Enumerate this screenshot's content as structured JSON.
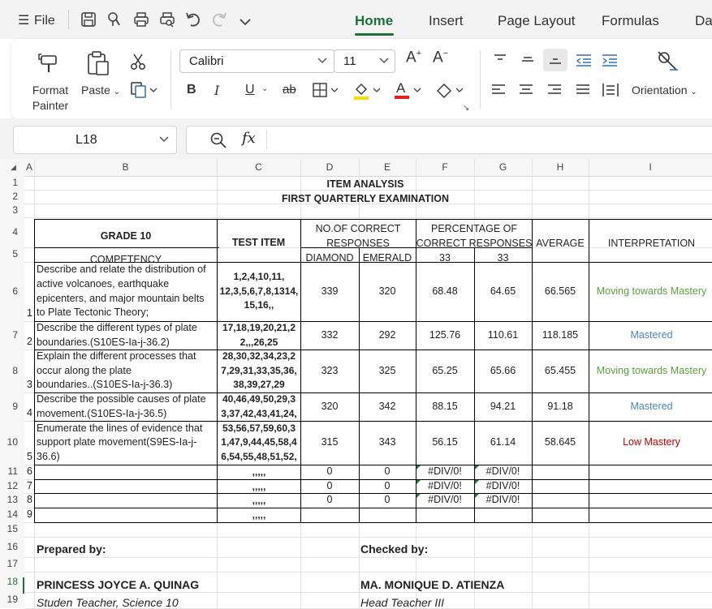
{
  "menubar": {
    "file_label": "File",
    "tabs": [
      "Home",
      "Insert",
      "Page Layout",
      "Formulas",
      "Da"
    ]
  },
  "ribbon": {
    "format_painter": "Format\nPainter",
    "paste": "Paste",
    "font_name": "Calibri",
    "font_size": "11",
    "orientation": "Orientation",
    "bold": "B",
    "italic": "I",
    "underline": "U",
    "strike": "ab"
  },
  "formula_bar": {
    "name_box": "L18",
    "fx": "fx",
    "value": ""
  },
  "grid": {
    "columns": [
      "A",
      "B",
      "C",
      "D",
      "E",
      "F",
      "G",
      "H",
      "I"
    ],
    "rows": [
      "1",
      "2",
      "3",
      "4",
      "5",
      "6",
      "7",
      "8",
      "9",
      "10",
      "11",
      "12",
      "13",
      "14",
      "15",
      "16",
      "17",
      "18",
      "19"
    ],
    "title1": "ITEM ANALYSIS",
    "title2": "FIRST QUARTERLY EXAMINATION",
    "header": {
      "grade": "GRADE 10",
      "test_item": "TEST ITEM",
      "correct_1": "NO.OF CORRECT",
      "correct_2": "RESPONSES",
      "pct_1": "PERCENTAGE OF",
      "pct_2": "CORRECT RESPONSES",
      "average": "AVERAGE",
      "interpretation": "INTERPRETATION",
      "competency": "COMPETENCY",
      "diamond": "DIAMOND",
      "emerald": "EMERALD",
      "n_diamond": "33",
      "n_emerald": "33"
    },
    "data_rows": [
      {
        "num": "1",
        "competency": [
          "Describe and relate the distribution of",
          "active volcanoes, earthquake",
          "epicenters, and major mountain belts",
          "to Plate Tectonic Theory;"
        ],
        "items": [
          "1,2,4,10,11,",
          "12,3,5,6,7,8,1314,",
          "15,16,,"
        ],
        "diamond": "339",
        "emerald": "320",
        "pct_d": "68.48",
        "pct_e": "64.65",
        "average": "66.565",
        "interpretation": "Moving towards Mastery",
        "color": "green"
      },
      {
        "num": "2",
        "competency": [
          "Describe the different types of plate",
          "boundaries.(S10ES-Ia-j-36.2)"
        ],
        "items": [
          "17,18,19,20,21,2",
          "2,,,26,25"
        ],
        "diamond": "332",
        "emerald": "292",
        "pct_d": "125.76",
        "pct_e": "110.61",
        "average": "118.185",
        "interpretation": "Mastered",
        "color": "blue"
      },
      {
        "num": "3",
        "competency": [
          "Explain the different processes that",
          "occur along the plate",
          "boundaries..(S10ES-Ia-j-36.3)"
        ],
        "items": [
          "28,30,32,34,23,2",
          "7,29,31,33,35,36,",
          "38,39,27,29"
        ],
        "diamond": "323",
        "emerald": "325",
        "pct_d": "65.25",
        "pct_e": "65.66",
        "average": "65.455",
        "interpretation": "Moving towards Mastery",
        "color": "green"
      },
      {
        "num": "4",
        "competency": [
          "Describe the possible causes of plate",
          "movement.(S10ES-Ia-j-36.5)"
        ],
        "items": [
          "40,46,49,50,29,3",
          "3,37,42,43,41,24,"
        ],
        "diamond": "320",
        "emerald": "342",
        "pct_d": "88.15",
        "pct_e": "94.21",
        "average": "91.18",
        "interpretation": "Mastered",
        "color": "blue"
      },
      {
        "num": "5",
        "competency": [
          "Enumerate the lines of evidence that",
          "support plate movement(S9ES-Ia-j-",
          "36.6)"
        ],
        "items": [
          "53,56,57,59,60,3",
          "1,47,9,44,45,58,4",
          "6,54,55,48,51,52,"
        ],
        "diamond": "315",
        "emerald": "343",
        "pct_d": "56.15",
        "pct_e": "61.14",
        "average": "58.645",
        "interpretation": "Low Mastery",
        "color": "red"
      }
    ],
    "empty_rows": [
      {
        "num": "6",
        "items": ",,,,,",
        "diamond": "0",
        "emerald": "0",
        "pct_d": "#DIV/0!",
        "pct_e": "#DIV/0!"
      },
      {
        "num": "7",
        "items": ",,,,,",
        "diamond": "0",
        "emerald": "0",
        "pct_d": "#DIV/0!",
        "pct_e": "#DIV/0!"
      },
      {
        "num": "8",
        "items": ",,,,,",
        "diamond": "0",
        "emerald": "0",
        "pct_d": "#DIV/0!",
        "pct_e": "#DIV/0!"
      },
      {
        "num": "9",
        "items": ",,,,,",
        "diamond": "",
        "emerald": "",
        "pct_d": "",
        "pct_e": ""
      }
    ],
    "prepared_by": "Prepared by:",
    "checked_by": "Checked by:",
    "preparer_name": "PRINCESS JOYCE A. QUINAG",
    "preparer_title": "Studen Teacher, Science 10",
    "checker_name": "MA. MONIQUE D. ATIENZA",
    "checker_title": "Head Teacher III"
  }
}
